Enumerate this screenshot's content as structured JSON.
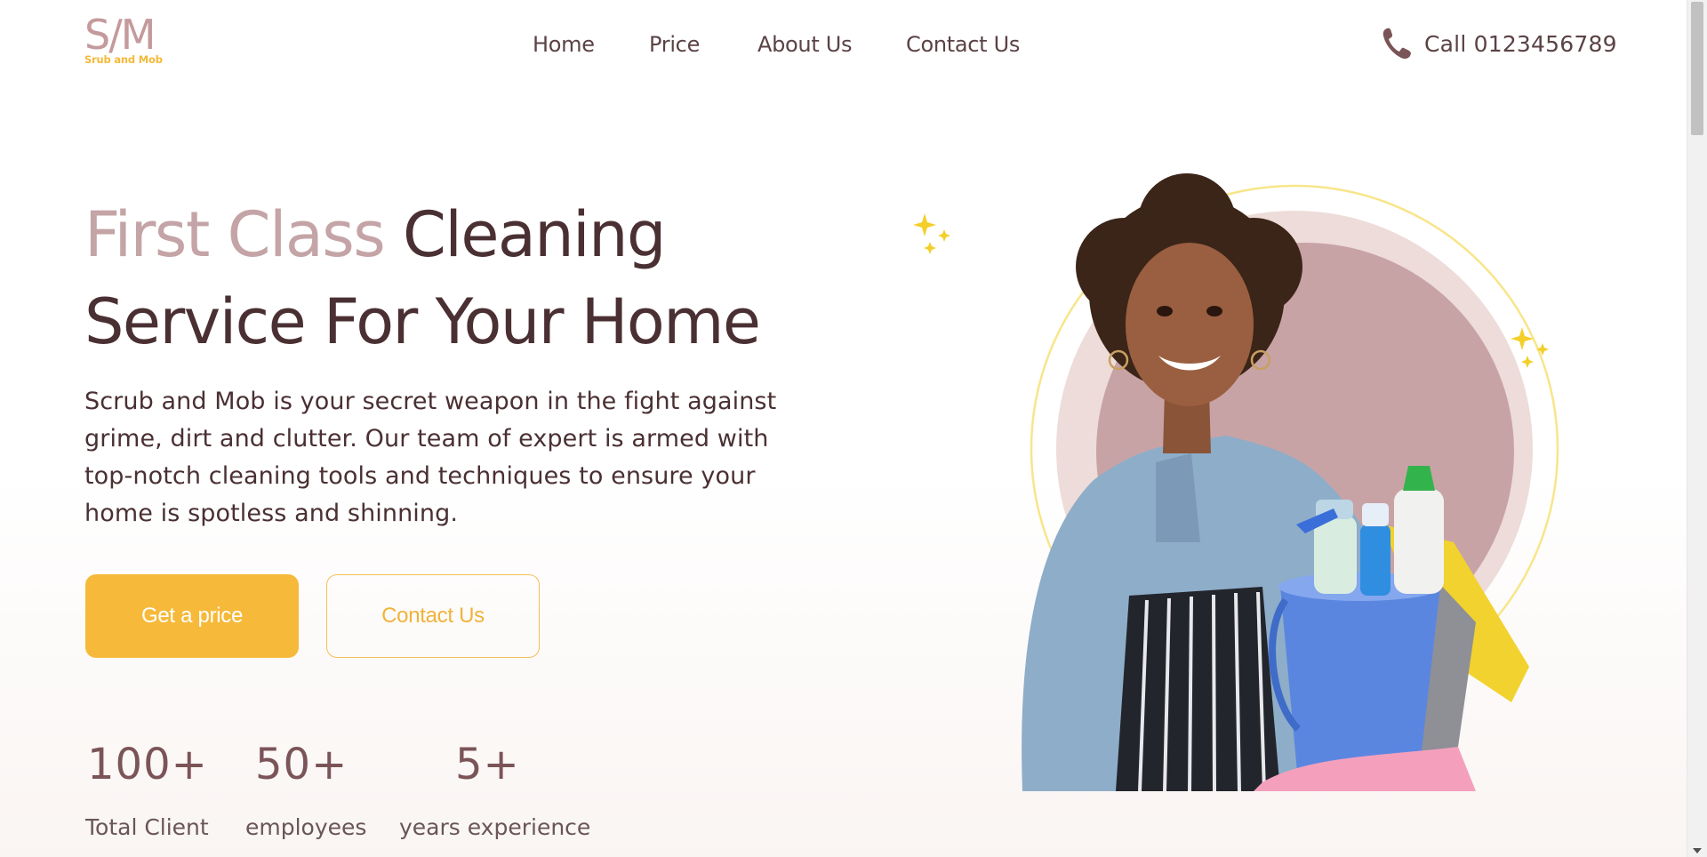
{
  "brand": {
    "logo_mark": "S/M",
    "logo_sub": "Srub and Mob"
  },
  "nav": {
    "items": [
      {
        "label": "Home"
      },
      {
        "label": "Price"
      },
      {
        "label": "About Us"
      },
      {
        "label": "Contact Us"
      }
    ]
  },
  "call": {
    "label": "Call 0123456789",
    "icon": "phone-icon"
  },
  "hero": {
    "title_accent": "First Class",
    "title_rest_line1": "Cleaning",
    "title_line2": "Service For Your Home",
    "description": "Scrub and Mob is your secret weapon in the fight against grime, dirt and clutter. Our team of expert is armed with top-notch cleaning tools and techniques to ensure your home is spotless and shinning.",
    "primary_button": "Get a price",
    "secondary_button": "Contact Us"
  },
  "stats": [
    {
      "value": "100+",
      "label": "Total Client"
    },
    {
      "value": "50+",
      "label": "employees"
    },
    {
      "value": "5+",
      "label": "years experience"
    }
  ],
  "colors": {
    "accent_yellow": "#f6b93a",
    "brand_rose": "#c49a9c",
    "text_dark": "#4a3033"
  }
}
